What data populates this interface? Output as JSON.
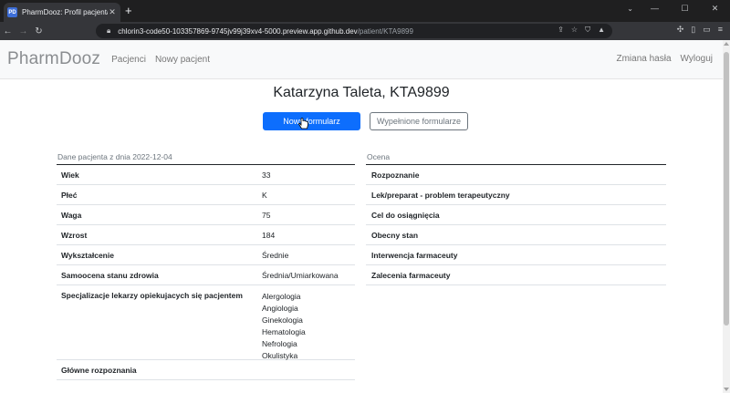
{
  "browser": {
    "tab_title": "PharmDooz: Profil pacjenta",
    "favicon_text": "PD",
    "url_host": "chlorin3-code50-103357869-9745jv99j39xv4-5000.preview.app.github.dev",
    "url_path": "/patient/KTA9899"
  },
  "nav": {
    "brand": "PharmDooz",
    "links": [
      "Pacjenci",
      "Nowy pacjent"
    ],
    "right": [
      "Zmiana hasła",
      "Wyloguj"
    ]
  },
  "page": {
    "title": "Katarzyna Taleta, KTA9899",
    "btn_new_form": "Nowy formularz",
    "btn_filled_forms": "Wypełnione formularze"
  },
  "patient_table": {
    "caption": "Dane pacjenta z dnia 2022-12-04",
    "rows": [
      {
        "key": "Wiek",
        "value": "33"
      },
      {
        "key": "Płeć",
        "value": "K"
      },
      {
        "key": "Waga",
        "value": "75"
      },
      {
        "key": "Wzrost",
        "value": "184"
      },
      {
        "key": "Wykształcenie",
        "value": "Średnie"
      },
      {
        "key": "Samoocena stanu zdrowia",
        "value": "Średnia/Umiarkowana"
      }
    ],
    "specializations_key": "Specjalizacje lekarzy opiekujacych się pacjentem",
    "specializations": [
      "Alergologia",
      "Angiologia",
      "Ginekologia",
      "Hematologia",
      "Nefrologia",
      "Okulistyka"
    ],
    "main_diagnoses_key": "Główne rozpoznania"
  },
  "assessment_table": {
    "caption": "Ocena",
    "rows": [
      "Rozpoznanie",
      "Lek/preparat - problem terapeutyczny",
      "Cel do osiągnięcia",
      "Obecny stan",
      "Interwencja farmaceuty",
      "Zalecenia farmaceuty"
    ]
  }
}
